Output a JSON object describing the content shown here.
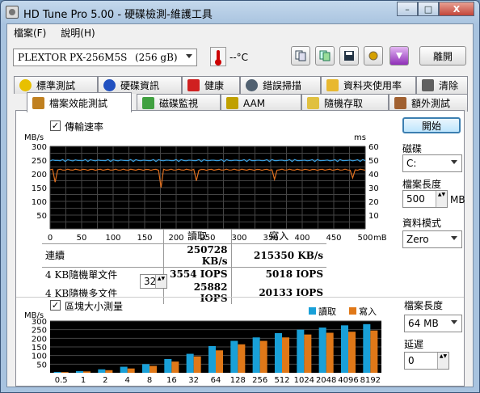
{
  "window": {
    "title": "HD Tune Pro  5.00 - 硬碟檢測-維護工具",
    "min": "–",
    "max": "□",
    "close": "X"
  },
  "menu": [
    "檔案(F)",
    "說明(H)"
  ],
  "toolbar": {
    "drive": "PLEXTOR PX-256M5S",
    "capacity": "(256 gB)",
    "temp": "--°C",
    "exit": "離開"
  },
  "tabs_row1": [
    {
      "label": "標準測試",
      "icon": "lightbulb-icon",
      "color": "#e8c000"
    },
    {
      "label": "硬碟資訊",
      "icon": "info-icon",
      "color": "#2050c0"
    },
    {
      "label": "健康",
      "icon": "plus-icon",
      "color": "#d02020"
    },
    {
      "label": "錯誤掃描",
      "icon": "magnifier-icon",
      "color": "#506070"
    },
    {
      "label": "資料夾使用率",
      "icon": "folder-icon",
      "color": "#e8b830"
    },
    {
      "label": "清除",
      "icon": "trash-icon",
      "color": "#606060"
    }
  ],
  "tabs_row2": [
    {
      "label": "檔案效能測試",
      "icon": "file-icon",
      "color": "#c08020"
    },
    {
      "label": "磁碟監視",
      "icon": "monitor-icon",
      "color": "#40a040"
    },
    {
      "label": "AAM",
      "icon": "speaker-icon",
      "color": "#c0a000"
    },
    {
      "label": "隨機存取",
      "icon": "dice-icon",
      "color": "#e0c040"
    },
    {
      "label": "額外測試",
      "icon": "extra-icon",
      "color": "#a06030"
    }
  ],
  "transfer": {
    "checkbox_label": "傳輸速率",
    "unit_left": "MB/s",
    "unit_right": "ms",
    "unit_x": "mB",
    "yticks_left": [
      "300",
      "250",
      "200",
      "150",
      "100",
      "50"
    ],
    "yticks_right": [
      "60",
      "50",
      "40",
      "30",
      "20",
      "10"
    ],
    "xticks": [
      "0",
      "50",
      "100",
      "150",
      "200",
      "250",
      "300",
      "350",
      "400",
      "450",
      "500"
    ]
  },
  "chart_data": [
    {
      "type": "line",
      "title": "",
      "xlabel": "mB",
      "ylabel": "MB/s",
      "xlim": [
        0,
        500
      ],
      "ylim": [
        0,
        300
      ],
      "y2lim": [
        0,
        60
      ],
      "series": [
        {
          "name": "讀取",
          "color": "#3aa0e0",
          "axis": "left",
          "summary": "flat around 250 MB/s"
        },
        {
          "name": "寫入",
          "color": "#e07020",
          "axis": "left",
          "summary": "flat around 215 MB/s with dips to ~150 near 0, 175, 230, 355, 480 mB"
        }
      ],
      "grid": true
    },
    {
      "type": "bar",
      "title": "",
      "ylabel": "MB/s",
      "categories": [
        "0.5",
        "1",
        "2",
        "4",
        "8",
        "16",
        "32",
        "64",
        "128",
        "256",
        "512",
        "1024",
        "2048",
        "4096",
        "8192"
      ],
      "ylim": [
        0,
        300
      ],
      "legend": "top-right",
      "series": [
        {
          "name": "讀取",
          "color": "#19a0d8",
          "values": [
            5,
            10,
            20,
            35,
            50,
            80,
            110,
            155,
            185,
            205,
            230,
            250,
            262,
            275,
            282
          ]
        },
        {
          "name": "寫入",
          "color": "#e07818",
          "values": [
            4,
            8,
            15,
            25,
            40,
            65,
            95,
            130,
            165,
            185,
            205,
            222,
            232,
            238,
            245
          ]
        }
      ]
    }
  ],
  "results": {
    "header_read": "讀取",
    "header_write": "寫入",
    "rows": [
      {
        "label": "連續",
        "read": "250728 KB/s",
        "write": "215350 KB/s"
      },
      {
        "label": "4 KB隨機單文件",
        "read": "3554 IOPS",
        "write": "5018 IOPS"
      },
      {
        "label": "4 KB隨機多文件",
        "read": "25882 IOPS",
        "write": "20133 IOPS"
      }
    ],
    "queue": "32"
  },
  "blocksize": {
    "checkbox_label": "區塊大小測量",
    "unit": "MB/s",
    "legend_read": "讀取",
    "legend_write": "寫入",
    "yticks": [
      "300",
      "250",
      "200",
      "150",
      "100",
      "50"
    ]
  },
  "side": {
    "start": "開始",
    "drive_label": "磁碟",
    "drive_value": "C:",
    "filesize_label": "檔案長度",
    "filesize_value": "500",
    "filesize_unit": "MB",
    "pattern_label": "資料模式",
    "pattern_value": "Zero",
    "bs_filesize_label": "檔案長度",
    "bs_filesize_value": "64 MB",
    "delay_label": "延遲",
    "delay_value": "0"
  }
}
